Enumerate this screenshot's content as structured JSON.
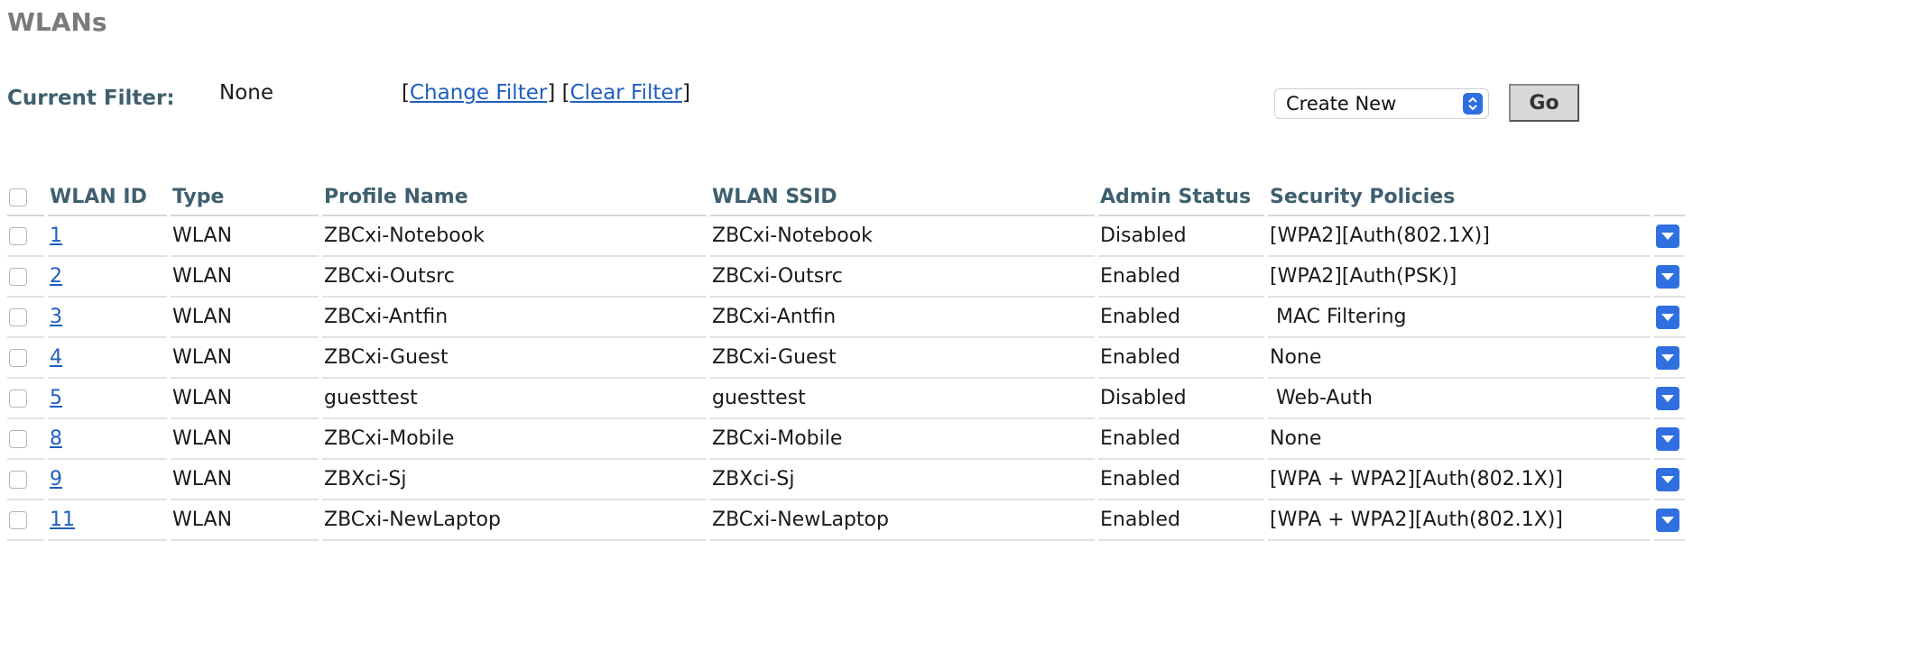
{
  "page": {
    "title": "WLANs"
  },
  "filter": {
    "label": "Current Filter:",
    "value": "None",
    "change_label": "Change Filter",
    "clear_label": "Clear Filter"
  },
  "action": {
    "selected": "Create New",
    "go_label": "Go"
  },
  "table": {
    "headers": {
      "id": "WLAN ID",
      "type": "Type",
      "profile": "Profile Name",
      "ssid": "WLAN SSID",
      "admin": "Admin Status",
      "security": "Security Policies"
    },
    "rows": [
      {
        "id": "1",
        "type": "WLAN",
        "profile": "ZBCxi-Notebook",
        "ssid": "ZBCxi-Notebook",
        "admin": "Disabled",
        "security": "[WPA2][Auth(802.1X)]"
      },
      {
        "id": "2",
        "type": "WLAN",
        "profile": "ZBCxi-Outsrc",
        "ssid": "ZBCxi-Outsrc",
        "admin": "Enabled",
        "security": "[WPA2][Auth(PSK)]"
      },
      {
        "id": "3",
        "type": "WLAN",
        "profile": "ZBCxi-Antfin",
        "ssid": "ZBCxi-Antfin",
        "admin": "Enabled",
        "security": " MAC Filtering"
      },
      {
        "id": "4",
        "type": "WLAN",
        "profile": "ZBCxi-Guest",
        "ssid": "ZBCxi-Guest",
        "admin": "Enabled",
        "security": "None"
      },
      {
        "id": "5",
        "type": "WLAN",
        "profile": "guesttest",
        "ssid": "guesttest",
        "admin": "Disabled",
        "security": " Web-Auth"
      },
      {
        "id": "8",
        "type": "WLAN",
        "profile": "ZBCxi-Mobile",
        "ssid": "ZBCxi-Mobile",
        "admin": "Enabled",
        "security": "None"
      },
      {
        "id": "9",
        "type": "WLAN",
        "profile": "ZBXci-Sj",
        "ssid": "ZBXci-Sj",
        "admin": "Enabled",
        "security": "[WPA + WPA2][Auth(802.1X)]"
      },
      {
        "id": "11",
        "type": "WLAN",
        "profile": "ZBCxi-NewLaptop",
        "ssid": "ZBCxi-NewLaptop",
        "admin": "Enabled",
        "security": "[WPA + WPA2][Auth(802.1X)]"
      }
    ]
  },
  "icons": {
    "checkbox": "checkbox-icon",
    "select_arrows": "select-arrows-icon",
    "row_dropdown": "dropdown-arrow-icon"
  },
  "colors": {
    "header_text": "#3f5f6f",
    "title_text": "#7a7a7a",
    "link": "#1f5fbf",
    "accent": "#2f6fe0"
  }
}
